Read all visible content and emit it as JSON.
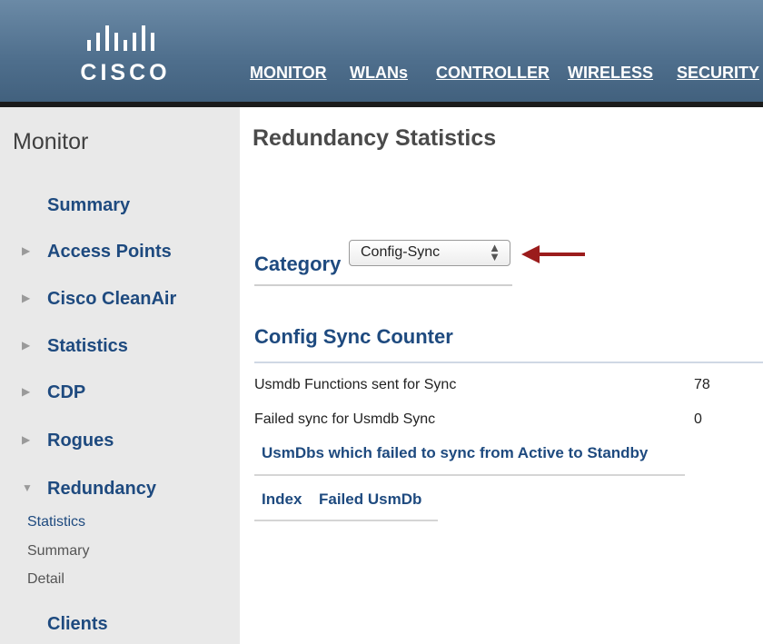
{
  "header": {
    "logo_text": "CISCO",
    "nav": [
      {
        "label": "MONITOR"
      },
      {
        "label": "WLANs"
      },
      {
        "label": "CONTROLLER"
      },
      {
        "label": "WIRELESS"
      },
      {
        "label": "SECURITY"
      }
    ]
  },
  "sidebar": {
    "title": "Monitor",
    "items": [
      {
        "label": "Summary",
        "icon": "none"
      },
      {
        "label": "Access Points",
        "icon": "triangle-right-icon"
      },
      {
        "label": "Cisco CleanAir",
        "icon": "triangle-right-icon"
      },
      {
        "label": "Statistics",
        "icon": "triangle-right-icon"
      },
      {
        "label": "CDP",
        "icon": "triangle-right-icon"
      },
      {
        "label": "Rogues",
        "icon": "triangle-right-icon"
      },
      {
        "label": "Redundancy",
        "icon": "triangle-down-icon"
      }
    ],
    "redundancy_subitems": [
      {
        "label": "Statistics",
        "active": true
      },
      {
        "label": "Summary"
      },
      {
        "label": "Detail"
      }
    ],
    "clients_label": "Clients"
  },
  "main": {
    "title": "Redundancy Statistics",
    "category_label": "Category",
    "category_value": "Config-Sync",
    "section_title": "Config Sync Counter",
    "rows": [
      {
        "label": "Usmdb Functions sent for Sync",
        "value": "78"
      },
      {
        "label": "Failed sync for Usmdb Sync",
        "value": "0"
      }
    ],
    "subsection_title": "UsmDbs which failed to sync from Active to Standby",
    "columns": [
      "Index",
      "Failed UsmDb"
    ]
  },
  "colors": {
    "header_blue": "#4f6f8d",
    "link_blue": "#1e4a7f",
    "annotation_arrow": "#9b1c1c",
    "sidebar_bg": "#e9e9e9"
  }
}
